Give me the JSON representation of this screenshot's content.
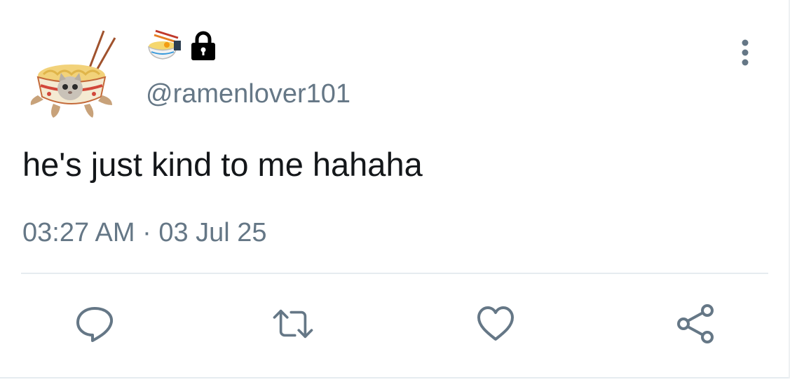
{
  "user": {
    "handle": "@ramenlover101",
    "avatar_icon": "ramen-bowl-cat-avatar",
    "display_name_icon": "ramen-emoji-icon",
    "protected_icon": "lock-icon"
  },
  "tweet": {
    "text": "he's just kind to me hahaha",
    "timestamp": "03:27 AM · 03 Jul 25"
  },
  "actions": {
    "reply_icon": "reply-icon",
    "retweet_icon": "retweet-icon",
    "like_icon": "heart-icon",
    "share_icon": "share-icon"
  },
  "colors": {
    "text": "#14171a",
    "secondary": "#657786",
    "divider": "#e6ecf0"
  }
}
